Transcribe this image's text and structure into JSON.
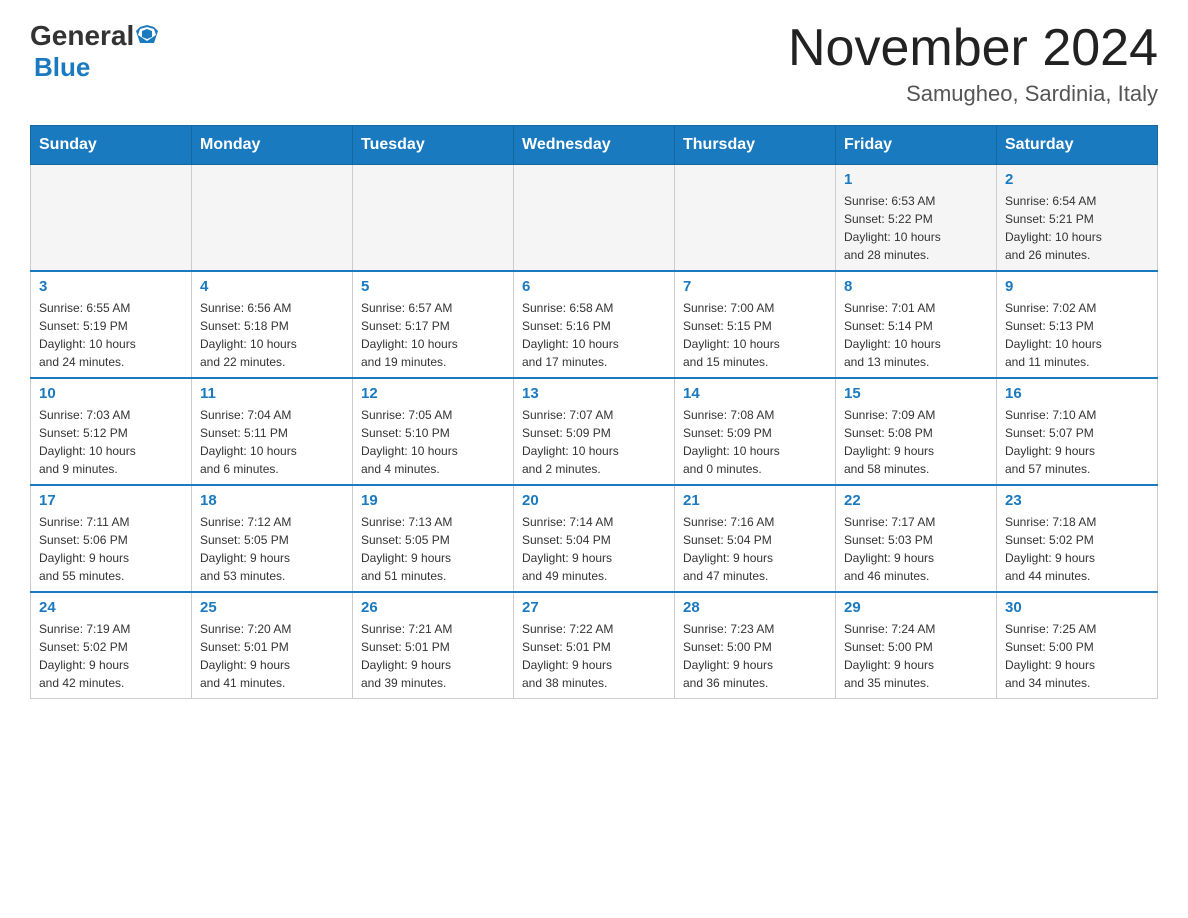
{
  "header": {
    "logo_general": "General",
    "logo_blue": "Blue",
    "month_title": "November 2024",
    "subtitle": "Samugheo, Sardinia, Italy"
  },
  "weekdays": [
    "Sunday",
    "Monday",
    "Tuesday",
    "Wednesday",
    "Thursday",
    "Friday",
    "Saturday"
  ],
  "weeks": [
    [
      {
        "day": "",
        "info": ""
      },
      {
        "day": "",
        "info": ""
      },
      {
        "day": "",
        "info": ""
      },
      {
        "day": "",
        "info": ""
      },
      {
        "day": "",
        "info": ""
      },
      {
        "day": "1",
        "info": "Sunrise: 6:53 AM\nSunset: 5:22 PM\nDaylight: 10 hours\nand 28 minutes."
      },
      {
        "day": "2",
        "info": "Sunrise: 6:54 AM\nSunset: 5:21 PM\nDaylight: 10 hours\nand 26 minutes."
      }
    ],
    [
      {
        "day": "3",
        "info": "Sunrise: 6:55 AM\nSunset: 5:19 PM\nDaylight: 10 hours\nand 24 minutes."
      },
      {
        "day": "4",
        "info": "Sunrise: 6:56 AM\nSunset: 5:18 PM\nDaylight: 10 hours\nand 22 minutes."
      },
      {
        "day": "5",
        "info": "Sunrise: 6:57 AM\nSunset: 5:17 PM\nDaylight: 10 hours\nand 19 minutes."
      },
      {
        "day": "6",
        "info": "Sunrise: 6:58 AM\nSunset: 5:16 PM\nDaylight: 10 hours\nand 17 minutes."
      },
      {
        "day": "7",
        "info": "Sunrise: 7:00 AM\nSunset: 5:15 PM\nDaylight: 10 hours\nand 15 minutes."
      },
      {
        "day": "8",
        "info": "Sunrise: 7:01 AM\nSunset: 5:14 PM\nDaylight: 10 hours\nand 13 minutes."
      },
      {
        "day": "9",
        "info": "Sunrise: 7:02 AM\nSunset: 5:13 PM\nDaylight: 10 hours\nand 11 minutes."
      }
    ],
    [
      {
        "day": "10",
        "info": "Sunrise: 7:03 AM\nSunset: 5:12 PM\nDaylight: 10 hours\nand 9 minutes."
      },
      {
        "day": "11",
        "info": "Sunrise: 7:04 AM\nSunset: 5:11 PM\nDaylight: 10 hours\nand 6 minutes."
      },
      {
        "day": "12",
        "info": "Sunrise: 7:05 AM\nSunset: 5:10 PM\nDaylight: 10 hours\nand 4 minutes."
      },
      {
        "day": "13",
        "info": "Sunrise: 7:07 AM\nSunset: 5:09 PM\nDaylight: 10 hours\nand 2 minutes."
      },
      {
        "day": "14",
        "info": "Sunrise: 7:08 AM\nSunset: 5:09 PM\nDaylight: 10 hours\nand 0 minutes."
      },
      {
        "day": "15",
        "info": "Sunrise: 7:09 AM\nSunset: 5:08 PM\nDaylight: 9 hours\nand 58 minutes."
      },
      {
        "day": "16",
        "info": "Sunrise: 7:10 AM\nSunset: 5:07 PM\nDaylight: 9 hours\nand 57 minutes."
      }
    ],
    [
      {
        "day": "17",
        "info": "Sunrise: 7:11 AM\nSunset: 5:06 PM\nDaylight: 9 hours\nand 55 minutes."
      },
      {
        "day": "18",
        "info": "Sunrise: 7:12 AM\nSunset: 5:05 PM\nDaylight: 9 hours\nand 53 minutes."
      },
      {
        "day": "19",
        "info": "Sunrise: 7:13 AM\nSunset: 5:05 PM\nDaylight: 9 hours\nand 51 minutes."
      },
      {
        "day": "20",
        "info": "Sunrise: 7:14 AM\nSunset: 5:04 PM\nDaylight: 9 hours\nand 49 minutes."
      },
      {
        "day": "21",
        "info": "Sunrise: 7:16 AM\nSunset: 5:04 PM\nDaylight: 9 hours\nand 47 minutes."
      },
      {
        "day": "22",
        "info": "Sunrise: 7:17 AM\nSunset: 5:03 PM\nDaylight: 9 hours\nand 46 minutes."
      },
      {
        "day": "23",
        "info": "Sunrise: 7:18 AM\nSunset: 5:02 PM\nDaylight: 9 hours\nand 44 minutes."
      }
    ],
    [
      {
        "day": "24",
        "info": "Sunrise: 7:19 AM\nSunset: 5:02 PM\nDaylight: 9 hours\nand 42 minutes."
      },
      {
        "day": "25",
        "info": "Sunrise: 7:20 AM\nSunset: 5:01 PM\nDaylight: 9 hours\nand 41 minutes."
      },
      {
        "day": "26",
        "info": "Sunrise: 7:21 AM\nSunset: 5:01 PM\nDaylight: 9 hours\nand 39 minutes."
      },
      {
        "day": "27",
        "info": "Sunrise: 7:22 AM\nSunset: 5:01 PM\nDaylight: 9 hours\nand 38 minutes."
      },
      {
        "day": "28",
        "info": "Sunrise: 7:23 AM\nSunset: 5:00 PM\nDaylight: 9 hours\nand 36 minutes."
      },
      {
        "day": "29",
        "info": "Sunrise: 7:24 AM\nSunset: 5:00 PM\nDaylight: 9 hours\nand 35 minutes."
      },
      {
        "day": "30",
        "info": "Sunrise: 7:25 AM\nSunset: 5:00 PM\nDaylight: 9 hours\nand 34 minutes."
      }
    ]
  ]
}
